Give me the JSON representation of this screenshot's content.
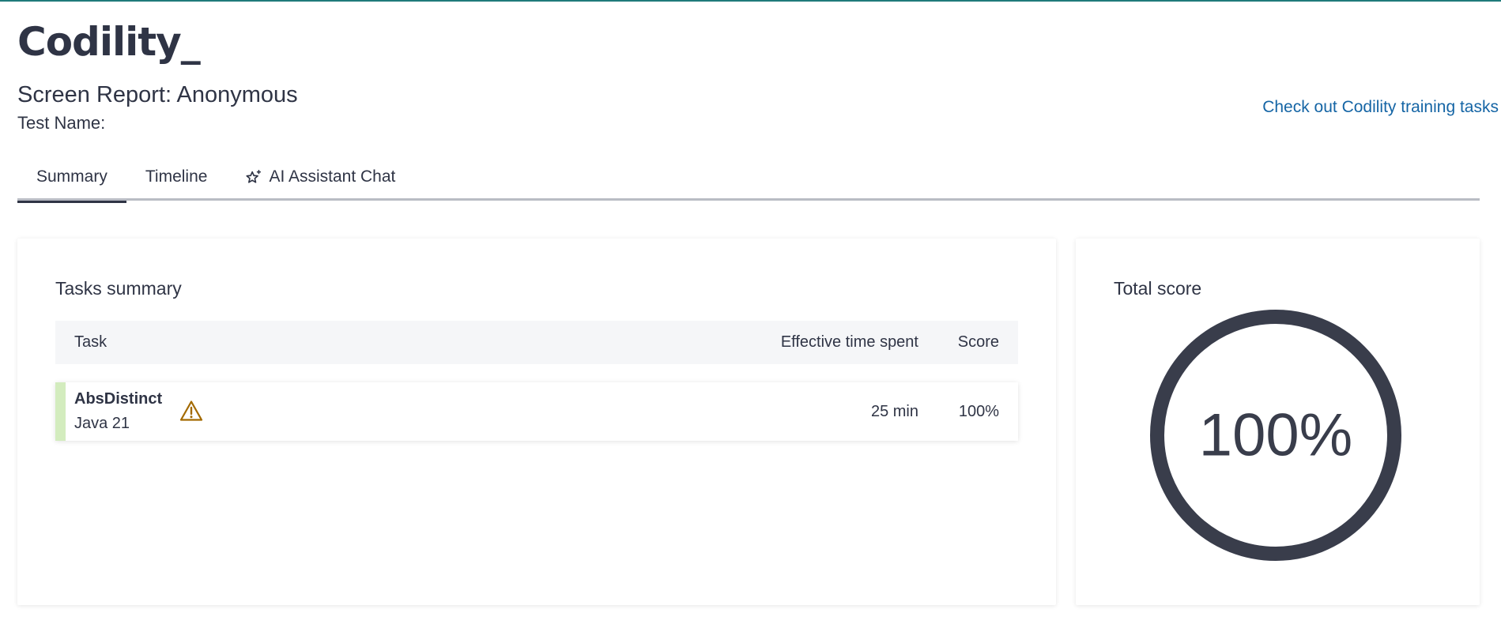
{
  "brand": {
    "logo": "Codility_",
    "accent_color": "#1f7a7a"
  },
  "header": {
    "report_title": "Screen Report: Anonymous",
    "test_name_label": "Test Name:",
    "training_link": "Check out Codility training tasks"
  },
  "tabs": [
    {
      "label": "Summary",
      "active": true
    },
    {
      "label": "Timeline",
      "active": false
    },
    {
      "label": "AI Assistant Chat",
      "active": false,
      "icon": "sparkle-star-icon"
    }
  ],
  "tasks_summary": {
    "title": "Tasks summary",
    "columns": {
      "task": "Task",
      "time": "Effective time spent",
      "score": "Score"
    },
    "rows": [
      {
        "name": "AbsDistinct",
        "language": "Java 21",
        "warning_icon": "warning-triangle-icon",
        "time": "25 min",
        "score": "100%",
        "status_color": "#d3ecbe"
      }
    ]
  },
  "total_score": {
    "title": "Total score",
    "value_text": "100%",
    "fraction": 1.0,
    "ring_color": "#393d4b"
  }
}
